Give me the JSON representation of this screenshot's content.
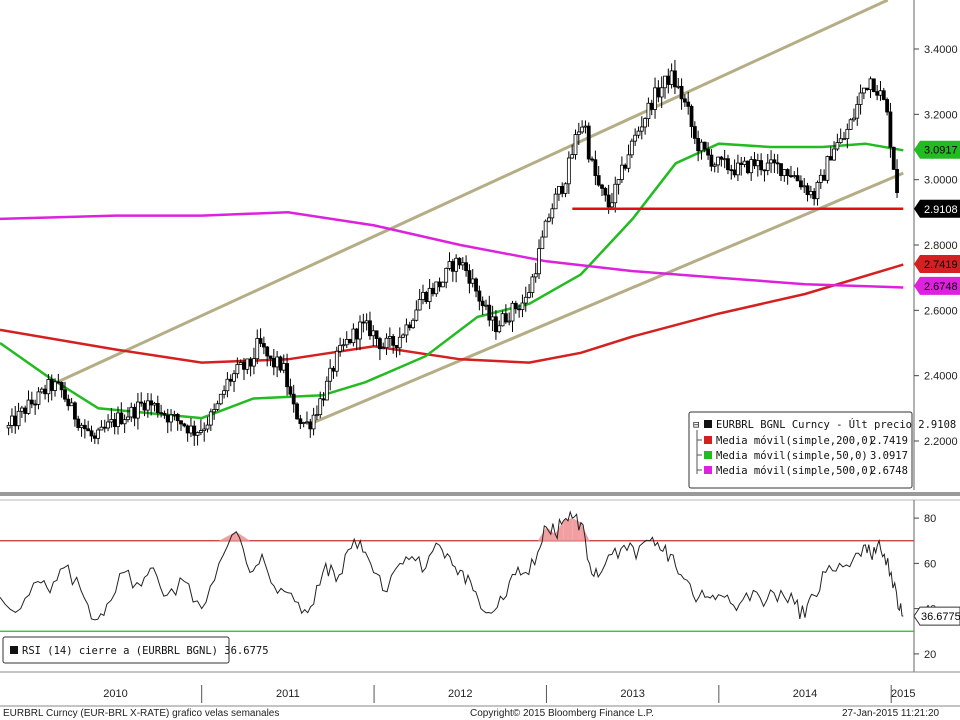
{
  "chart_data": [
    {
      "type": "candlestick",
      "ticker_label": "EURBRL BGNL Curncy - Últ precio",
      "last_price": "2.9108",
      "ylim": [
        2.05,
        3.55
      ],
      "y_ticks": [
        "3.4000",
        "3.2000",
        "3.0000",
        "2.8000",
        "2.6000",
        "2.4000",
        "2.2000"
      ],
      "x_period": [
        "2009-11",
        "2015-01"
      ],
      "colors": {
        "up": "#000000",
        "down": "#000000",
        "trendline": "#b5ad85",
        "support": "#e01010"
      },
      "price_path": [
        [
          2009.88,
          2.24
        ],
        [
          2009.98,
          2.3
        ],
        [
          2010.05,
          2.33
        ],
        [
          2010.12,
          2.37
        ],
        [
          2010.18,
          2.36
        ],
        [
          2010.25,
          2.29
        ],
        [
          2010.32,
          2.24
        ],
        [
          2010.38,
          2.2
        ],
        [
          2010.45,
          2.24
        ],
        [
          2010.52,
          2.27
        ],
        [
          2010.6,
          2.29
        ],
        [
          2010.67,
          2.32
        ],
        [
          2010.75,
          2.3
        ],
        [
          2010.82,
          2.27
        ],
        [
          2010.88,
          2.26
        ],
        [
          2010.95,
          2.23
        ],
        [
          2011.0,
          2.24
        ],
        [
          2011.08,
          2.29
        ],
        [
          2011.15,
          2.38
        ],
        [
          2011.22,
          2.42
        ],
        [
          2011.28,
          2.43
        ],
        [
          2011.33,
          2.5
        ],
        [
          2011.4,
          2.44
        ],
        [
          2011.47,
          2.43
        ],
        [
          2011.53,
          2.3
        ],
        [
          2011.58,
          2.26
        ],
        [
          2011.62,
          2.25
        ],
        [
          2011.66,
          2.29
        ],
        [
          2011.72,
          2.36
        ],
        [
          2011.78,
          2.45
        ],
        [
          2011.84,
          2.5
        ],
        [
          2011.92,
          2.55
        ],
        [
          2011.98,
          2.54
        ],
        [
          2012.05,
          2.49
        ],
        [
          2012.12,
          2.5
        ],
        [
          2012.2,
          2.56
        ],
        [
          2012.27,
          2.64
        ],
        [
          2012.33,
          2.66
        ],
        [
          2012.4,
          2.69
        ],
        [
          2012.45,
          2.74
        ],
        [
          2012.5,
          2.75
        ],
        [
          2012.55,
          2.71
        ],
        [
          2012.6,
          2.65
        ],
        [
          2012.66,
          2.58
        ],
        [
          2012.7,
          2.55
        ],
        [
          2012.76,
          2.58
        ],
        [
          2012.82,
          2.61
        ],
        [
          2012.88,
          2.63
        ],
        [
          2012.92,
          2.7
        ],
        [
          2012.97,
          2.8
        ],
        [
          2013.02,
          2.9
        ],
        [
          2013.06,
          2.95
        ],
        [
          2013.1,
          2.99
        ],
        [
          2013.14,
          3.06
        ],
        [
          2013.18,
          3.15
        ],
        [
          2013.22,
          3.18
        ],
        [
          2013.25,
          3.07
        ],
        [
          2013.3,
          2.98
        ],
        [
          2013.36,
          2.92
        ],
        [
          2013.42,
          2.99
        ],
        [
          2013.48,
          3.09
        ],
        [
          2013.55,
          3.17
        ],
        [
          2013.62,
          3.25
        ],
        [
          2013.68,
          3.29
        ],
        [
          2013.72,
          3.32
        ],
        [
          2013.78,
          3.26
        ],
        [
          2013.82,
          3.21
        ],
        [
          2013.86,
          3.12
        ],
        [
          2013.92,
          3.08
        ],
        [
          2013.98,
          3.05
        ],
        [
          2014.05,
          3.04
        ],
        [
          2014.12,
          3.03
        ],
        [
          2014.2,
          3.05
        ],
        [
          2014.28,
          3.04
        ],
        [
          2014.35,
          3.04
        ],
        [
          2014.42,
          3.02
        ],
        [
          2014.48,
          2.99
        ],
        [
          2014.55,
          2.95
        ],
        [
          2014.6,
          3.0
        ],
        [
          2014.66,
          3.1
        ],
        [
          2014.72,
          3.12
        ],
        [
          2014.78,
          3.19
        ],
        [
          2014.83,
          3.27
        ],
        [
          2014.88,
          3.31
        ],
        [
          2014.93,
          3.27
        ],
        [
          2014.97,
          3.22
        ],
        [
          2015.01,
          3.06
        ],
        [
          2015.05,
          2.91
        ]
      ],
      "moving_averages": [
        {
          "name": "Media móvil(simple,200,0)",
          "last": "2.7419",
          "color": "#d42020",
          "points": [
            [
              2009.83,
              2.54
            ],
            [
              2010.5,
              2.48
            ],
            [
              2011.0,
              2.44
            ],
            [
              2011.5,
              2.45
            ],
            [
              2012.0,
              2.49
            ],
            [
              2012.5,
              2.45
            ],
            [
              2012.9,
              2.44
            ],
            [
              2013.2,
              2.47
            ],
            [
              2013.5,
              2.52
            ],
            [
              2014.0,
              2.59
            ],
            [
              2014.5,
              2.65
            ],
            [
              2015.07,
              2.74
            ]
          ]
        },
        {
          "name": "Media móvil(simple,50,0)",
          "last": "3.0917",
          "color": "#22bb22",
          "points": [
            [
              2009.83,
              2.5
            ],
            [
              2010.1,
              2.4
            ],
            [
              2010.4,
              2.3
            ],
            [
              2010.8,
              2.28
            ],
            [
              2011.0,
              2.27
            ],
            [
              2011.3,
              2.33
            ],
            [
              2011.7,
              2.34
            ],
            [
              2011.95,
              2.38
            ],
            [
              2012.3,
              2.46
            ],
            [
              2012.6,
              2.58
            ],
            [
              2012.9,
              2.62
            ],
            [
              2013.2,
              2.71
            ],
            [
              2013.5,
              2.88
            ],
            [
              2013.75,
              3.05
            ],
            [
              2014.0,
              3.11
            ],
            [
              2014.3,
              3.1
            ],
            [
              2014.6,
              3.1
            ],
            [
              2014.85,
              3.11
            ],
            [
              2015.07,
              3.09
            ]
          ]
        },
        {
          "name": "Media móvil(simple,500,0)",
          "last": "2.6748",
          "color": "#dd22dd",
          "points": [
            [
              2009.83,
              2.88
            ],
            [
              2010.5,
              2.89
            ],
            [
              2011.0,
              2.89
            ],
            [
              2011.5,
              2.9
            ],
            [
              2012.0,
              2.86
            ],
            [
              2012.5,
              2.8
            ],
            [
              2013.0,
              2.75
            ],
            [
              2013.5,
              2.72
            ],
            [
              2014.0,
              2.7
            ],
            [
              2014.5,
              2.68
            ],
            [
              2015.07,
              2.67
            ]
          ]
        }
      ]
    },
    {
      "type": "line",
      "name": "RSI (14) cierre a (EURBRL BGNL) 36.6775",
      "last": "36.6775",
      "ylim": [
        12,
        88
      ],
      "y_ticks": [
        "80",
        "60",
        "40",
        "20"
      ],
      "overbought": 70,
      "oversold": 30,
      "colors": {
        "line": "#222222",
        "overbought": "#c03030",
        "oversold": "#22bb22",
        "fill": "#f0a0a0"
      },
      "values": [
        [
          2009.83,
          45
        ],
        [
          2009.95,
          40
        ],
        [
          2010.05,
          52
        ],
        [
          2010.12,
          47
        ],
        [
          2010.2,
          58
        ],
        [
          2010.3,
          48
        ],
        [
          2010.38,
          35
        ],
        [
          2010.45,
          42
        ],
        [
          2010.55,
          56
        ],
        [
          2010.65,
          50
        ],
        [
          2010.72,
          58
        ],
        [
          2010.8,
          46
        ],
        [
          2010.9,
          52
        ],
        [
          2011.0,
          40
        ],
        [
          2011.1,
          60
        ],
        [
          2011.2,
          74
        ],
        [
          2011.28,
          56
        ],
        [
          2011.35,
          64
        ],
        [
          2011.42,
          50
        ],
        [
          2011.5,
          47
        ],
        [
          2011.58,
          38
        ],
        [
          2011.65,
          42
        ],
        [
          2011.72,
          60
        ],
        [
          2011.78,
          52
        ],
        [
          2011.85,
          66
        ],
        [
          2011.92,
          70
        ],
        [
          2011.98,
          60
        ],
        [
          2012.05,
          48
        ],
        [
          2012.15,
          60
        ],
        [
          2012.22,
          63
        ],
        [
          2012.3,
          58
        ],
        [
          2012.38,
          68
        ],
        [
          2012.44,
          63
        ],
        [
          2012.5,
          57
        ],
        [
          2012.56,
          52
        ],
        [
          2012.62,
          40
        ],
        [
          2012.68,
          38
        ],
        [
          2012.75,
          44
        ],
        [
          2012.82,
          55
        ],
        [
          2012.88,
          56
        ],
        [
          2012.95,
          65
        ],
        [
          2013.0,
          76
        ],
        [
          2013.05,
          73
        ],
        [
          2013.1,
          79
        ],
        [
          2013.15,
          80
        ],
        [
          2013.2,
          78
        ],
        [
          2013.25,
          60
        ],
        [
          2013.3,
          54
        ],
        [
          2013.38,
          64
        ],
        [
          2013.45,
          68
        ],
        [
          2013.52,
          62
        ],
        [
          2013.6,
          70
        ],
        [
          2013.66,
          66
        ],
        [
          2013.72,
          64
        ],
        [
          2013.78,
          55
        ],
        [
          2013.85,
          46
        ],
        [
          2013.92,
          45
        ],
        [
          2013.98,
          44
        ],
        [
          2014.05,
          46
        ],
        [
          2014.12,
          42
        ],
        [
          2014.2,
          48
        ],
        [
          2014.28,
          44
        ],
        [
          2014.36,
          48
        ],
        [
          2014.44,
          42
        ],
        [
          2014.5,
          36
        ],
        [
          2014.55,
          46
        ],
        [
          2014.62,
          56
        ],
        [
          2014.7,
          60
        ],
        [
          2014.78,
          62
        ],
        [
          2014.84,
          68
        ],
        [
          2014.88,
          64
        ],
        [
          2014.92,
          68
        ],
        [
          2014.96,
          64
        ],
        [
          2015.0,
          56
        ],
        [
          2015.04,
          40
        ],
        [
          2015.07,
          36.7
        ]
      ]
    }
  ],
  "legend": {
    "title": "EURBRL BGNL Curncy - Últ precio 2.9108",
    "rows": [
      {
        "label": "Media móvil(simple,200,0)",
        "value": "2.7419",
        "color": "#d42020"
      },
      {
        "label": "Media móvil(simple,50,0)",
        "value": "3.0917",
        "color": "#22bb22"
      },
      {
        "label": "Media móvil(simple,500,0)",
        "value": "2.6748",
        "color": "#dd22dd"
      }
    ]
  },
  "rsi_legend": {
    "label": "RSI (14) cierre a (EURBRL BGNL) 36.6775"
  },
  "x_axis": {
    "years": [
      "2010",
      "2011",
      "2012",
      "2013",
      "2014",
      "2015"
    ]
  },
  "footer": {
    "left": "EURBRL Curncy (EUR-BRL X-RATE) grafico velas semanales",
    "center": "Copyright© 2015 Bloomberg Finance L.P.",
    "right": "27-Jan-2015 11:21:20"
  }
}
